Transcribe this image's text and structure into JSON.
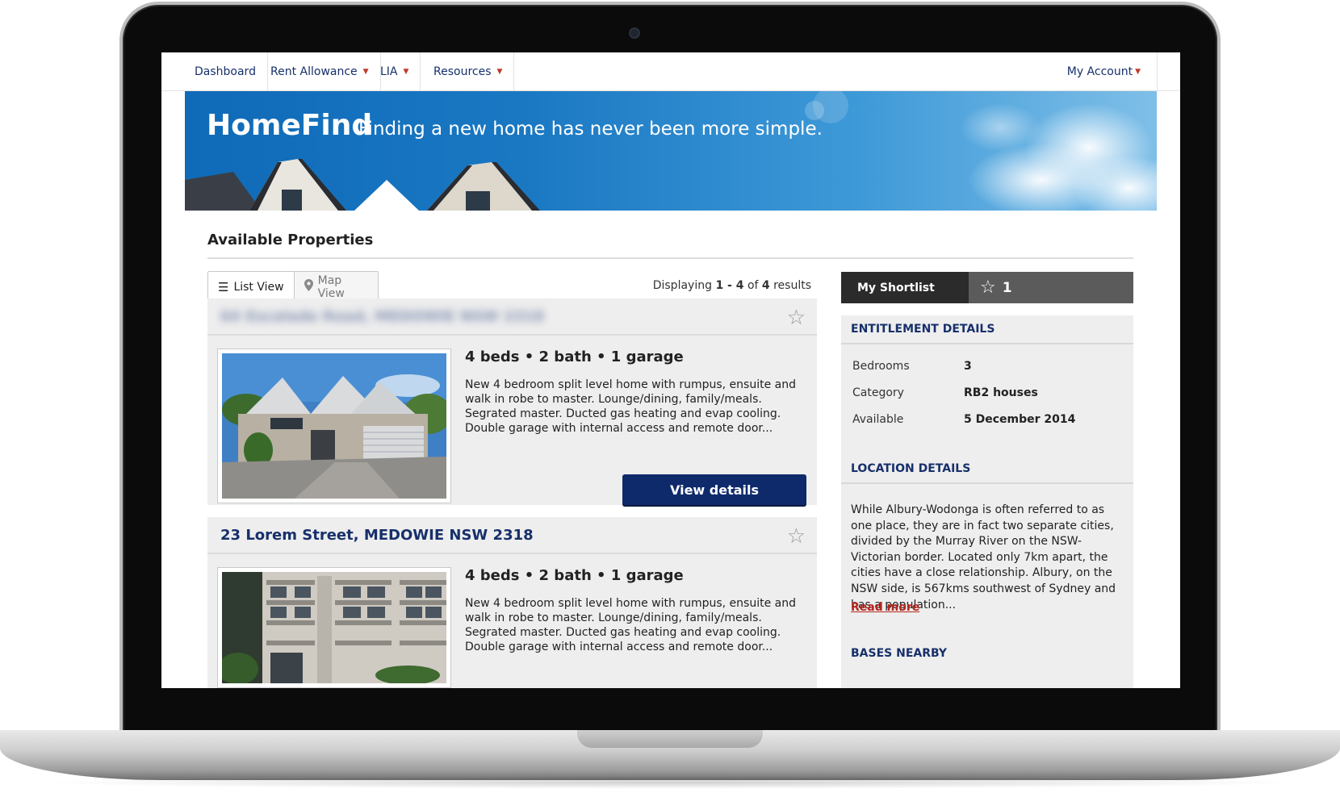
{
  "nav": {
    "items": [
      {
        "label": "Dashboard",
        "has_menu": false
      },
      {
        "label": "Rent Allowance",
        "has_menu": true
      },
      {
        "label": "LIA",
        "has_menu": true
      },
      {
        "label": "Resources",
        "has_menu": true
      }
    ],
    "account_label": "My Account"
  },
  "hero": {
    "title": "HomeFind",
    "subtitle": "Finding a new home has never been more simple."
  },
  "main": {
    "section_title": "Available Properties",
    "view_toggle": {
      "list_label": "List View",
      "map_label": "Map View",
      "active": "list"
    },
    "results": {
      "prefix": "Displaying",
      "range": "1 - 4",
      "of": "of",
      "total": "4",
      "suffix": "results"
    }
  },
  "properties": [
    {
      "address": "64 Escalade Road, MEDOWIE NSW 2318",
      "address_blurred": true,
      "specs": "4 beds • 2 bath • 1 garage",
      "description": "New 4 bedroom split level home with rumpus, ensuite and walk in robe to master. Lounge/dining, family/meals. Segrated master. Ducted gas heating and evap cooling. Double garage with internal access and remote door...",
      "button_label": "View details"
    },
    {
      "address": "23 Lorem Street, MEDOWIE NSW 2318",
      "address_blurred": false,
      "specs": "4 beds • 2 bath • 1 garage",
      "description": "New 4 bedroom split level home with rumpus, ensuite and walk in robe to master. Lounge/dining, family/meals. Segrated master. Ducted gas heating and evap cooling. Double garage with internal access and remote door...",
      "button_label": "View details"
    }
  ],
  "sidebar": {
    "shortlist_label": "My Shortlist",
    "shortlist_count": "1",
    "entitlement_heading": "ENTITLEMENT DETAILS",
    "entitlement": [
      {
        "label": "Bedrooms",
        "value": "3"
      },
      {
        "label": "Category",
        "value": "RB2 houses"
      },
      {
        "label": "Available",
        "value": "5 December 2014"
      }
    ],
    "location_heading": "LOCATION DETAILS",
    "location_text": "While Albury-Wodonga is often referred to as one place, they are in fact two separate cities, divided by the Murray River on the NSW-Victorian border. Located only 7km apart, the cities have a close relationship. Albury, on the NSW side, is 567kms southwest of Sydney and has a population...",
    "read_more_label": "Read more",
    "bases_heading": "BASES NEARBY"
  },
  "colors": {
    "brand_navy": "#0e2a6b",
    "link_navy": "#17306b",
    "accent_red": "#b5261e",
    "hero_blue": "#1a78c3",
    "card_bg": "#eeeeee"
  }
}
